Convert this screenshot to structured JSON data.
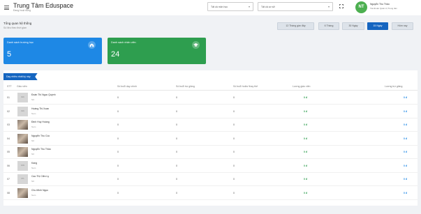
{
  "header": {
    "title": "Trung Tâm Eduspace",
    "subtitle": "Đang hoạt động",
    "subject_select": "Tất cả môn học",
    "facility_select": "Tất cả cơ sở",
    "avatar_initials": "NT",
    "user_name": "Nguyễn Thu Thảo",
    "user_role": "Tài khoản Quản trị Trung tâm"
  },
  "overview": {
    "title": "Tổng quan hệ thống",
    "subtitle": "Số liệu theo thời gian",
    "filters": [
      {
        "label": "12 Tháng gần đây",
        "active": false
      },
      {
        "label": "6 Tháng",
        "active": false
      },
      {
        "label": "30 Ngày",
        "active": false
      },
      {
        "label": "15 Ngày",
        "active": true
      },
      {
        "label": "Hôm nay",
        "active": false
      }
    ]
  },
  "cards": {
    "schools": {
      "label": "Danh sách trường học",
      "value": "5",
      "icon": "school-icon",
      "color": "#1e88e5"
    },
    "staff": {
      "label": "Danh sách nhân viên",
      "value": "24",
      "icon": "graduation-cap-icon",
      "color": "#2e9e4f"
    }
  },
  "table": {
    "ribbon": "Dạy nhiều nhất kỳ này",
    "columns": [
      "STT",
      "Giáo viên",
      "Số buổi dạy chính",
      "Số buổi trợ giảng",
      "Số buổi hoãn/ thay thế",
      "Lương giáo viên",
      "Lương trợ giảng"
    ],
    "rows": [
      {
        "stt": "01",
        "photo_text": "AVA",
        "has_photo": false,
        "name": "Đoàn Thị Ngọc Quỳnh",
        "gender": "Nữ",
        "main": "0",
        "assist": "0",
        "postponed": "0",
        "salary": "0 đ",
        "assist_salary": "0 đ"
      },
      {
        "stt": "02",
        "photo_text": "AVA",
        "has_photo": false,
        "name": "Hoàng Thị Xoan",
        "gender": "Nam",
        "main": "0",
        "assist": "0",
        "postponed": "0",
        "salary": "0 đ",
        "assist_salary": "0 đ"
      },
      {
        "stt": "03",
        "photo_text": "",
        "has_photo": true,
        "name": "Đinh Huy Hoàng",
        "gender": "Nam",
        "main": "0",
        "assist": "0",
        "postponed": "0",
        "salary": "0 đ",
        "assist_salary": "0 đ"
      },
      {
        "stt": "04",
        "photo_text": "",
        "has_photo": true,
        "name": "Nguyễn Thu Cúc",
        "gender": "Nữ",
        "main": "0",
        "assist": "0",
        "postponed": "0",
        "salary": "0 đ",
        "assist_salary": "0 đ"
      },
      {
        "stt": "05",
        "photo_text": "",
        "has_photo": true,
        "name": "Nguyễn Thu Thảo",
        "gender": "Nữ",
        "main": "0",
        "assist": "0",
        "postponed": "0",
        "salary": "0 đ",
        "assist_salary": "0 đ"
      },
      {
        "stt": "06",
        "photo_text": "KAN",
        "has_photo": false,
        "name": "Kang",
        "gender": "Nam",
        "main": "0",
        "assist": "0",
        "postponed": "0",
        "salary": "0 đ",
        "assist_salary": "0 đ"
      },
      {
        "stt": "07",
        "photo_text": "CTL",
        "has_photo": false,
        "name": "Cao Thị Cẩm Ly",
        "gender": "Nữ",
        "main": "0",
        "assist": "0",
        "postponed": "0",
        "salary": "0 đ",
        "assist_salary": "0 đ"
      },
      {
        "stt": "08",
        "photo_text": "",
        "has_photo": true,
        "name": "Chu Minh Ngọc",
        "gender": "Nam",
        "main": "0",
        "assist": "0",
        "postponed": "0",
        "salary": "0 đ",
        "assist_salary": "0 đ"
      }
    ]
  },
  "colors": {
    "primary": "#1565c0",
    "success": "#2e9e4f",
    "info": "#1e88e5"
  }
}
